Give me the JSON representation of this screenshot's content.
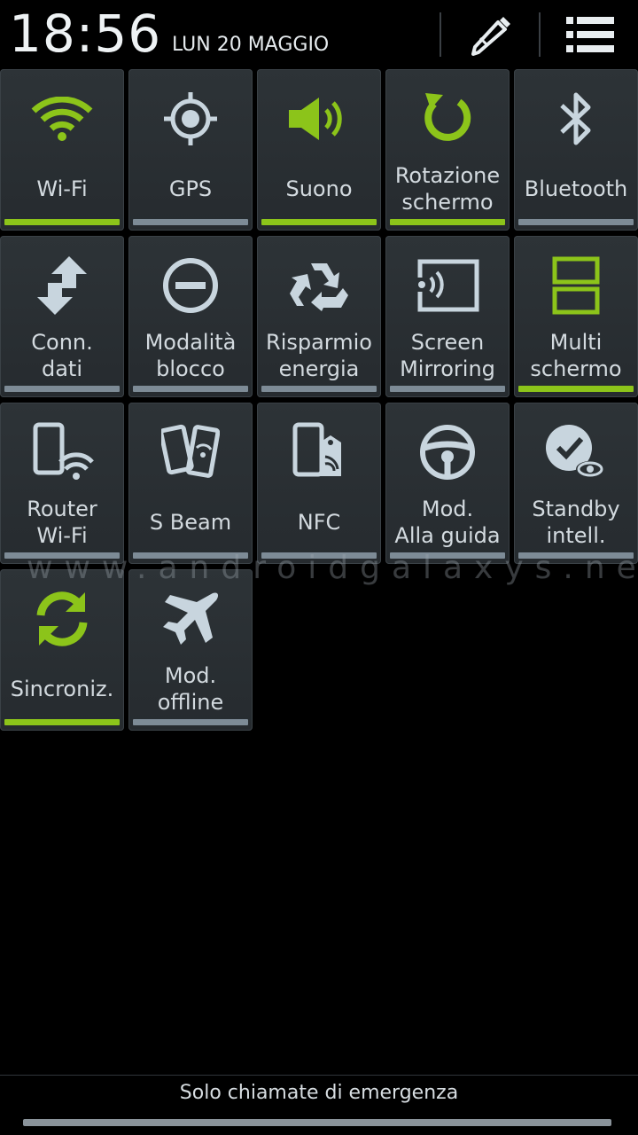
{
  "status": {
    "time": "18:56",
    "date": "LUN 20 MAGGIO"
  },
  "header": {
    "edit_icon": "pencil-icon",
    "list_icon": "list-icon"
  },
  "accent": "#8cc41a",
  "tiles": [
    {
      "label": "Wi-Fi",
      "icon": "wifi-icon",
      "on": true
    },
    {
      "label": "GPS",
      "icon": "gps-icon",
      "on": false
    },
    {
      "label": "Suono",
      "icon": "sound-icon",
      "on": true
    },
    {
      "label": "Rotazione\nschermo",
      "icon": "rotate-icon",
      "on": true
    },
    {
      "label": "Bluetooth",
      "icon": "bluetooth-icon",
      "on": false
    },
    {
      "label": "Conn.\ndati",
      "icon": "data-arrows-icon",
      "on": false
    },
    {
      "label": "Modalità\nblocco",
      "icon": "block-icon",
      "on": false
    },
    {
      "label": "Risparmio\nenergia",
      "icon": "recycle-icon",
      "on": false
    },
    {
      "label": "Screen\nMirroring",
      "icon": "screen-mirroring-icon",
      "on": false
    },
    {
      "label": "Multi\nschermo",
      "icon": "multi-window-icon",
      "on": true
    },
    {
      "label": "Router\nWi-Fi",
      "icon": "router-wifi-icon",
      "on": false
    },
    {
      "label": "S Beam",
      "icon": "s-beam-icon",
      "on": false
    },
    {
      "label": "NFC",
      "icon": "nfc-icon",
      "on": false
    },
    {
      "label": "Mod.\nAlla guida",
      "icon": "steering-wheel-icon",
      "on": false
    },
    {
      "label": "Standby\nintell.",
      "icon": "smart-stay-icon",
      "on": false
    },
    {
      "label": "Sincroniz.",
      "icon": "sync-icon",
      "on": true
    },
    {
      "label": "Mod.\noffline",
      "icon": "airplane-icon",
      "on": false
    }
  ],
  "watermark": "www.androidgalaxys.net",
  "footer": {
    "text": "Solo chiamate di emergenza"
  }
}
